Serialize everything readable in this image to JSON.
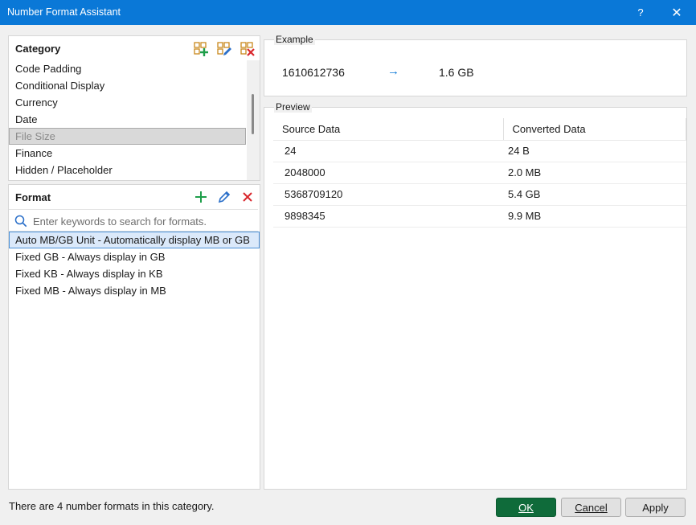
{
  "window": {
    "title": "Number Format Assistant",
    "help_label": "?",
    "close_label": "✕"
  },
  "category": {
    "label": "Category",
    "items": [
      {
        "label": "Code Padding"
      },
      {
        "label": "Conditional Display"
      },
      {
        "label": "Currency"
      },
      {
        "label": "Date"
      },
      {
        "label": "File Size",
        "selected": true
      },
      {
        "label": "Finance"
      },
      {
        "label": "Hidden / Placeholder"
      }
    ]
  },
  "format": {
    "label": "Format",
    "search_placeholder": "Enter keywords to search for formats.",
    "items": [
      {
        "label": "Auto MB/GB Unit - Automatically display MB or GB",
        "selected": true
      },
      {
        "label": "Fixed GB - Always display in GB"
      },
      {
        "label": "Fixed KB - Always display in KB"
      },
      {
        "label": "Fixed MB - Always display in MB"
      }
    ]
  },
  "example": {
    "label": "Example",
    "source": "1610612736",
    "arrow": "→",
    "result": "1.6 GB"
  },
  "preview": {
    "label": "Preview",
    "columns": [
      "Source Data",
      "Converted Data"
    ],
    "rows": [
      [
        "24",
        "24 B"
      ],
      [
        "2048000",
        "2.0 MB"
      ],
      [
        "5368709120",
        "5.4 GB"
      ],
      [
        "9898345",
        "9.9 MB"
      ]
    ]
  },
  "status_text": "There are 4 number formats in this category.",
  "buttons": {
    "ok": "OK",
    "cancel": "Cancel",
    "apply": "Apply"
  },
  "colors": {
    "titlebar": "#0a78d7",
    "ok_button": "#0f6b3a",
    "add_icon": "#1e9e4a",
    "delete_icon": "#d9262c",
    "edit_icon": "#2a6fc9"
  }
}
